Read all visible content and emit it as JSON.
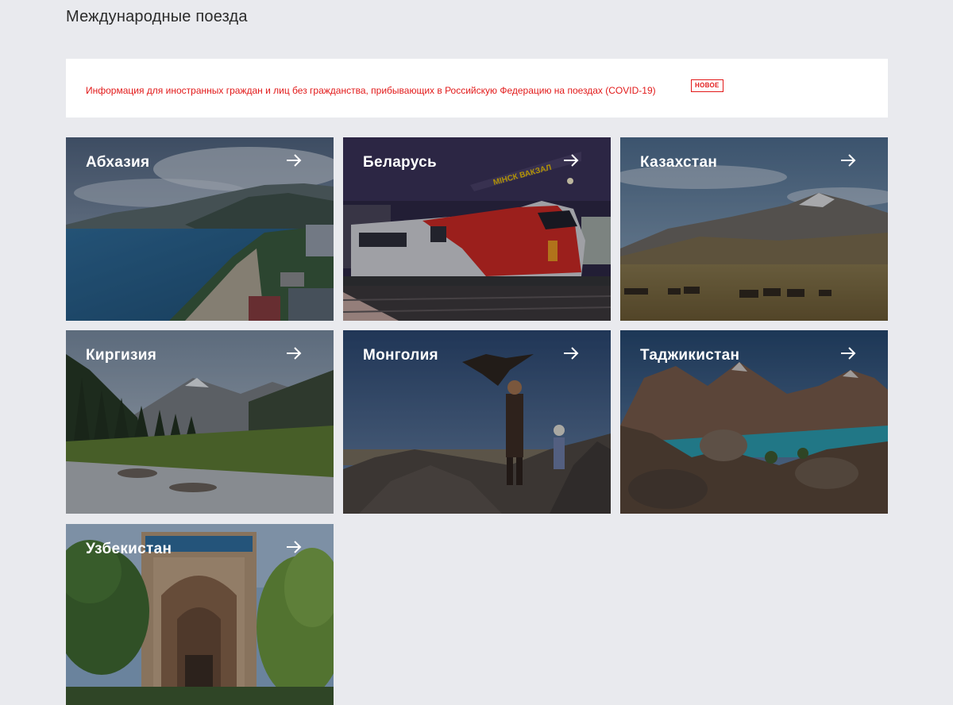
{
  "page": {
    "title": "Международные поезда"
  },
  "notice": {
    "text": "Информация для иностранных граждан и лиц без гражданства, прибывающих в Российскую Федерацию на поездах (COVID-19)",
    "badge": "НОВОЕ",
    "color": "#e21a1a"
  },
  "cards": [
    {
      "title": "Абхазия",
      "icon": "arrow-right-icon"
    },
    {
      "title": "Беларусь",
      "icon": "arrow-right-icon"
    },
    {
      "title": "Казахстан",
      "icon": "arrow-right-icon"
    },
    {
      "title": "Киргизия",
      "icon": "arrow-right-icon"
    },
    {
      "title": "Монголия",
      "icon": "arrow-right-icon"
    },
    {
      "title": "Таджикистан",
      "icon": "arrow-right-icon"
    },
    {
      "title": "Узбекистан",
      "icon": "arrow-right-icon"
    }
  ],
  "scenes": {
    "train_sign": "МІНСК ВАКЗАЛ"
  }
}
